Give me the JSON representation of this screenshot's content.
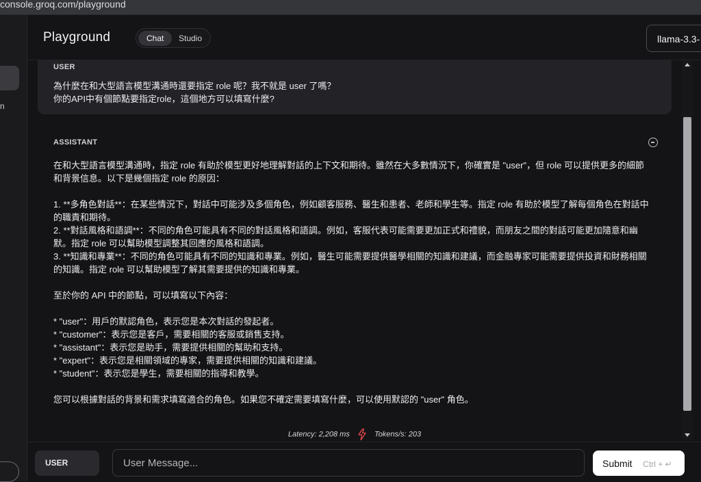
{
  "browser": {
    "url": "console.groq.com/playground"
  },
  "nav": {
    "fragment": "n"
  },
  "header": {
    "title": "Playground",
    "tabs": [
      "Chat",
      "Studio"
    ],
    "model": "llama-3.3-"
  },
  "user_message": {
    "role": "USER",
    "text": "為什麼在和大型語言模型溝通時還要指定 role 呢？我不就是 user 了嗎？\n你的API中有個節點要指定role，這個地方可以填寫什麼?"
  },
  "assistant_message": {
    "role": "ASSISTANT",
    "paragraphs": [
      "在和大型語言模型溝通時，指定 role 有助於模型更好地理解對話的上下文和期待。雖然在大多數情況下，你確實是 \"user\"，但 role 可以提供更多的細節和背景信息。以下是幾個指定 role 的原因：",
      "",
      "1. **多角色對話**：在某些情況下，對話中可能涉及多個角色，例如顧客服務、醫生和患者、老師和學生等。指定 role 有助於模型了解每個角色在對話中的職責和期待。",
      "2. **對話風格和語調**：不同的角色可能具有不同的對話風格和語調。例如，客服代表可能需要更加正式和禮貌，而朋友之間的對話可能更加隨意和幽默。指定 role 可以幫助模型調整其回應的風格和語調。",
      "3. **知識和專業**：不同的角色可能具有不同的知識和專業。例如，醫生可能需要提供醫學相關的知識和建議，而金融專家可能需要提供投資和財務相關的知識。指定 role 可以幫助模型了解其需要提供的知識和專業。",
      "",
      "至於你的 API 中的節點，可以填寫以下內容：",
      "",
      "* \"user\"：用戶的默認角色，表示您是本次對話的發起者。",
      "* \"customer\"：表示您是客戶，需要相關的客服或銷售支持。",
      "* \"assistant\"：表示您是助手，需要提供相關的幫助和支持。",
      "* \"expert\"：表示您是相關領域的專家，需要提供相關的知識和建議。",
      "* \"student\"：表示您是學生，需要相關的指導和教學。",
      "",
      "您可以根據對話的背景和需求填寫適合的角色。如果您不確定需要填寫什麼，可以使用默認的 \"user\" 角色。"
    ]
  },
  "stats": {
    "latency_label": "Latency:",
    "latency_value": "2,208 ms",
    "tokens_label": "Tokens/s:",
    "tokens_value": "203"
  },
  "composer": {
    "role": "USER",
    "placeholder": "User Message...",
    "submit_label": "Submit",
    "shortcut": "Ctrl + ↵"
  },
  "colors": {
    "background": "#141416",
    "card": "#232327",
    "accent_bolt": "#e5484d",
    "submit_bg": "#ffffff"
  },
  "icons": [
    "collapse-circle-icon",
    "lightning-bolt-icon",
    "scroll-up-arrow-icon",
    "scroll-down-arrow-icon"
  ]
}
